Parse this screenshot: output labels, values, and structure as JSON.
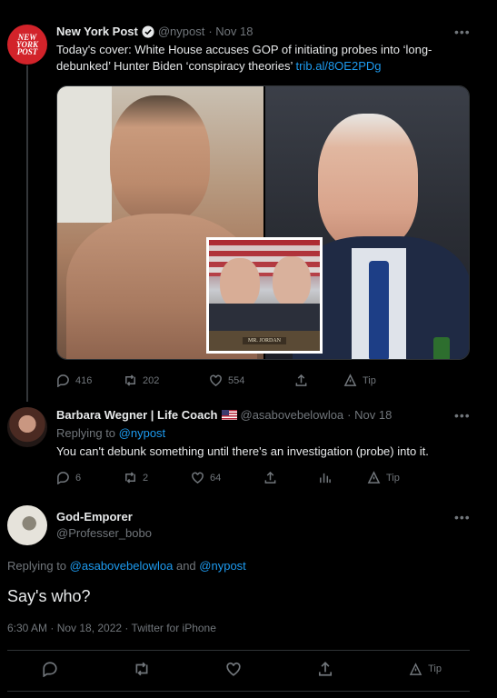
{
  "tweet1": {
    "display_name": "New York Post",
    "handle": "@nypost",
    "date": "· Nov 18",
    "text": "Today's cover: White House accuses GOP of initiating probes into ‘long-debunked’ Hunter Biden ‘conspiracy theories’",
    "link": "trib.al/8OE2PDg",
    "avatar_lines": [
      "NEW",
      "YORK",
      "POST"
    ],
    "inset_caption": "MR. JORDAN",
    "replies": "416",
    "retweets": "202",
    "likes": "554",
    "tip": "Tip"
  },
  "tweet2": {
    "display_name": "Barbara Wegner | Life Coach",
    "handle": "@asabovebelowloa",
    "date": "· Nov 18",
    "replying_prefix": "Replying to",
    "replying_to": "@nypost",
    "text": "You can't debunk something until there's an investigation (probe) into it.",
    "replies": "6",
    "retweets": "2",
    "likes": "64",
    "tip": "Tip"
  },
  "tweet3": {
    "display_name": "God-Emporer",
    "handle": "@Professer_bobo",
    "replying_prefix": "Replying to",
    "replying_to_1": "@asabovebelowloa",
    "replying_and": "and",
    "replying_to_2": "@nypost",
    "text": "Say's who?",
    "timestamp": "6:30 AM · Nov 18, 2022 · Twitter for iPhone",
    "tip": "Tip"
  },
  "colors": {
    "accent": "#1d9bf0",
    "muted": "#71767b",
    "background": "#000000",
    "nypost_red": "#d2232a"
  },
  "icons": [
    "reply-icon",
    "retweet-icon",
    "like-icon",
    "share-icon",
    "analytics-icon",
    "tip-icon",
    "verified-icon",
    "more-icon",
    "flag-icon"
  ]
}
